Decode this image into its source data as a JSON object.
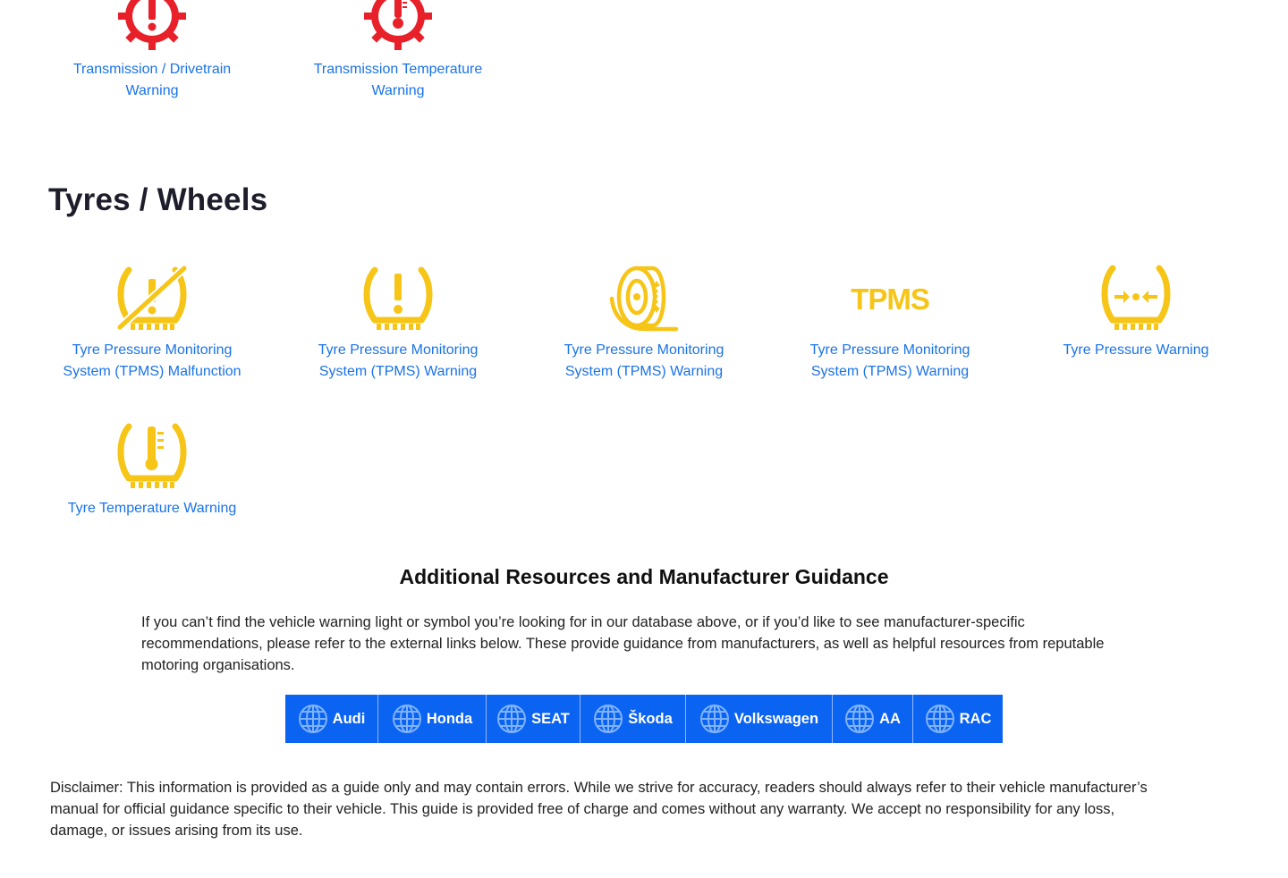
{
  "prev_section": {
    "items": [
      {
        "label_line1": "Transmission / Drivetrain",
        "label_line2": "Warning",
        "icon": "gear-exclamation-icon"
      },
      {
        "label_line1": "Transmission Temperature",
        "label_line2": "Warning",
        "icon": "gear-thermometer-icon"
      }
    ]
  },
  "section": {
    "title": "Tyres / Wheels",
    "items": [
      {
        "label_line1": "Tyre Pressure Monitoring",
        "label_line2": "System (TPMS) Malfunction",
        "icon": "tyre-exclamation-slash-icon"
      },
      {
        "label_line1": "Tyre Pressure Monitoring",
        "label_line2": "System (TPMS) Warning",
        "icon": "tyre-exclamation-icon"
      },
      {
        "label_line1": "Tyre Pressure Monitoring",
        "label_line2": "System (TPMS) Warning",
        "icon": "tyre-side-icon"
      },
      {
        "label_line1": "Tyre Pressure Monitoring",
        "label_line2": "System (TPMS) Warning",
        "icon": "tpms-text-icon",
        "icon_text": "TPMS"
      },
      {
        "label_line1": "Tyre Pressure Warning",
        "label_line2": "",
        "icon": "tyre-arrows-icon"
      },
      {
        "label_line1": "Tyre Temperature Warning",
        "label_line2": "",
        "icon": "tyre-thermometer-icon"
      }
    ]
  },
  "resources": {
    "title": "Additional Resources and Manufacturer Guidance",
    "text": "If you can’t find the vehicle warning light or symbol you’re looking for in our database above, or if you’d like to see manufacturer-specific recommendations, please refer to the external links below. These provide guidance from manufacturers, as well as helpful resources from reputable motoring organisations.",
    "links": [
      {
        "label": "Audi",
        "icon": "globe-icon"
      },
      {
        "label": "Honda",
        "icon": "globe-icon"
      },
      {
        "label": "SEAT",
        "icon": "globe-icon"
      },
      {
        "label": "Škoda",
        "icon": "globe-icon"
      },
      {
        "label": "Volkswagen",
        "icon": "globe-icon"
      },
      {
        "label": "AA",
        "icon": "globe-icon"
      },
      {
        "label": "RAC",
        "icon": "globe-icon"
      }
    ]
  },
  "disclaimer": "Disclaimer: This information is provided as a guide only and may contain errors. While we strive for accuracy, readers should always refer to their vehicle manufacturer’s manual for official guidance specific to their vehicle. This guide is provided free of charge and comes without any warranty. We accept no responsibility for any loss, damage, or issues arising from its use.",
  "colors": {
    "warning_red": "#e8202a",
    "warning_amber": "#f6c517",
    "link_blue": "#1a73e8",
    "button_blue": "#0b63f1"
  }
}
